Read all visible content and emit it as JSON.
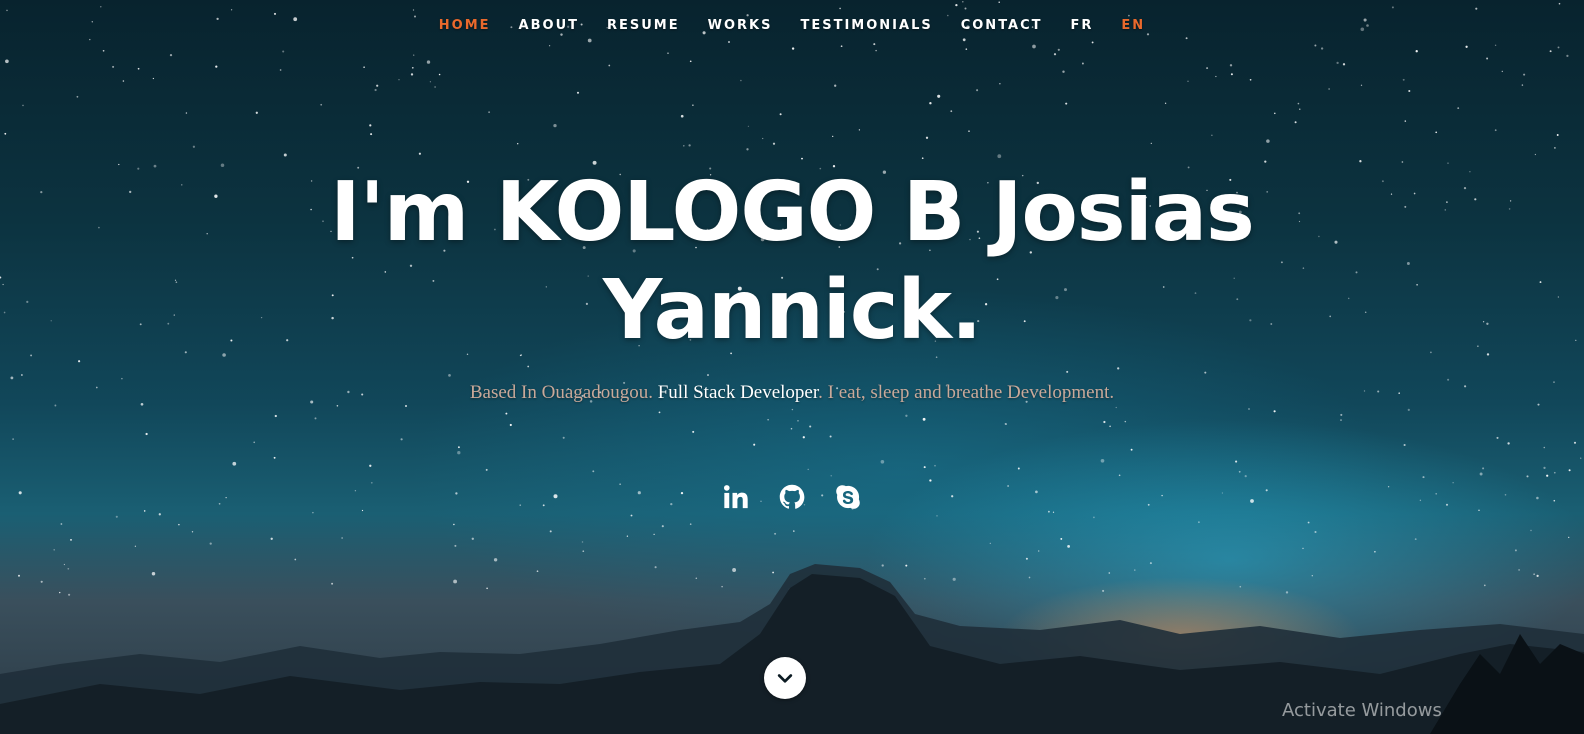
{
  "nav": {
    "items": [
      {
        "label": "HOME",
        "active": true
      },
      {
        "label": "ABOUT",
        "active": false
      },
      {
        "label": "RESUME",
        "active": false
      },
      {
        "label": "WORKS",
        "active": false
      },
      {
        "label": "TESTIMONIALS",
        "active": false
      },
      {
        "label": "CONTACT",
        "active": false
      },
      {
        "label": "FR",
        "active": false
      },
      {
        "label": "EN",
        "active": true
      }
    ],
    "active_color": "#e9692c"
  },
  "hero": {
    "title_line1": "I'm KOLOGO B Josias",
    "title_line2": "Yannick.",
    "subtitle_part1": "Based In Ouagadougou. ",
    "subtitle_highlight": "Full Stack Developer",
    "subtitle_part2": ". I eat, sleep and breathe Development."
  },
  "social": [
    {
      "icon": "linkedin-icon"
    },
    {
      "icon": "github-icon"
    },
    {
      "icon": "skype-icon"
    }
  ],
  "scroll_button": {
    "icon": "chevron-down-icon"
  },
  "watermark": "Activate Windows"
}
